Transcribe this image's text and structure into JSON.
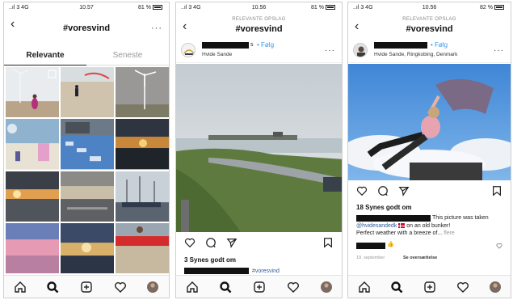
{
  "screens": [
    {
      "status": {
        "signal": "..ıl 3 4G",
        "time": "10.57",
        "battery": "81 %"
      },
      "nav": {
        "back": "‹",
        "title": "#voresvind",
        "more": "···"
      },
      "tabs": [
        "Relevante",
        "Seneste"
      ],
      "bottom_nav": [
        "home-icon",
        "search-icon",
        "add-icon",
        "heart-icon",
        "profile-avatar"
      ]
    },
    {
      "status": {
        "signal": "..ıl 3 4G",
        "time": "10.56",
        "battery": "81 %"
      },
      "nav": {
        "back": "‹",
        "subtitle": "RELEVANTE OPSLAG",
        "title": "#voresvind",
        "more": "···"
      },
      "post": {
        "username_suffix": "s",
        "follow": "• Følg",
        "location": "Hvide Sande",
        "likes": "3 Synes godt om",
        "caption_hashtag": "#voresvind"
      },
      "bottom_nav": [
        "home-icon",
        "search-icon",
        "add-icon",
        "heart-icon",
        "profile-avatar"
      ]
    },
    {
      "status": {
        "signal": "..ıl 3 4G",
        "time": "10.56",
        "battery": "82 %"
      },
      "nav": {
        "back": "‹",
        "subtitle": "RELEVANTE OPSLAG",
        "title": "#voresvind",
        "more": "···"
      },
      "post": {
        "follow": "• Følg",
        "location": "Hvide Sande, Ringkobing, Denmark",
        "likes": "18 Synes godt om",
        "caption_line1": "This picture was taken",
        "caption_line2_mention": "@hvidesandedk",
        "caption_line2_rest": " on an old bunker!",
        "caption_line3": "Perfect weather with a breeze of...",
        "caption_more": "flere",
        "comment_emoji": "👍",
        "date": "19. september",
        "translate": "Se oversættelse"
      },
      "bottom_nav": [
        "home-icon",
        "search-icon",
        "add-icon",
        "heart-icon",
        "profile-avatar"
      ]
    }
  ],
  "colors": {
    "link": "#3897f0",
    "hashtag": "#2d5b9c",
    "redaction": "#111111"
  }
}
